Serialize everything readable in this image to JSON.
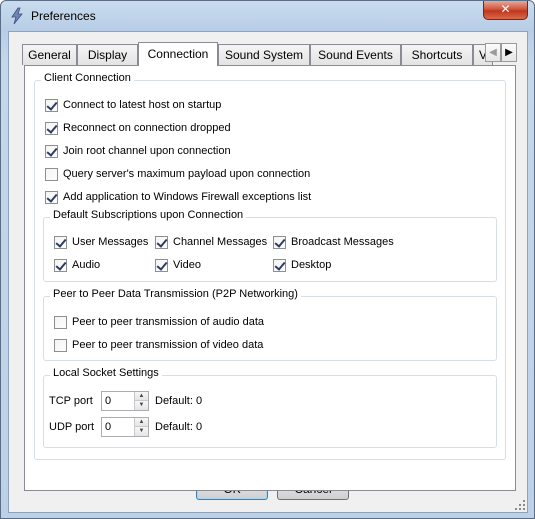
{
  "window": {
    "title": "Preferences",
    "close_glyph": "✕"
  },
  "tabs": [
    {
      "label": "General"
    },
    {
      "label": "Display"
    },
    {
      "label": "Connection",
      "selected": true
    },
    {
      "label": "Sound System"
    },
    {
      "label": "Sound Events"
    },
    {
      "label": "Shortcuts"
    },
    {
      "label": "V"
    }
  ],
  "tab_scroll": {
    "left_glyph": "◀",
    "right_glyph": "▶"
  },
  "client_connection": {
    "legend": "Client Connection",
    "options": [
      {
        "label": "Connect to latest host on startup",
        "checked": true
      },
      {
        "label": "Reconnect on connection dropped",
        "checked": true
      },
      {
        "label": "Join root channel upon connection",
        "checked": true
      },
      {
        "label": "Query server's maximum payload upon connection",
        "checked": false
      },
      {
        "label": "Add application to Windows Firewall exceptions list",
        "checked": true
      }
    ]
  },
  "default_subscriptions": {
    "legend": "Default Subscriptions upon Connection",
    "options": [
      {
        "label": "User Messages",
        "checked": true
      },
      {
        "label": "Channel Messages",
        "checked": true
      },
      {
        "label": "Broadcast Messages",
        "checked": true
      },
      {
        "label": "Audio",
        "checked": true
      },
      {
        "label": "Video",
        "checked": true
      },
      {
        "label": "Desktop",
        "checked": true
      }
    ]
  },
  "p2p": {
    "legend": "Peer to Peer Data Transmission (P2P Networking)",
    "options": [
      {
        "label": "Peer to peer transmission of audio data",
        "checked": false
      },
      {
        "label": "Peer to peer transmission of video data",
        "checked": false
      }
    ]
  },
  "local_socket": {
    "legend": "Local Socket Settings",
    "tcp": {
      "label": "TCP port",
      "value": "0",
      "default": "Default: 0"
    },
    "udp": {
      "label": "UDP port",
      "value": "0",
      "default": "Default: 0"
    }
  },
  "buttons": {
    "ok": "OK",
    "cancel": "Cancel"
  },
  "icons": {
    "app": "speaker-lightning-icon",
    "spin_up": "▲",
    "spin_down": "▼"
  }
}
